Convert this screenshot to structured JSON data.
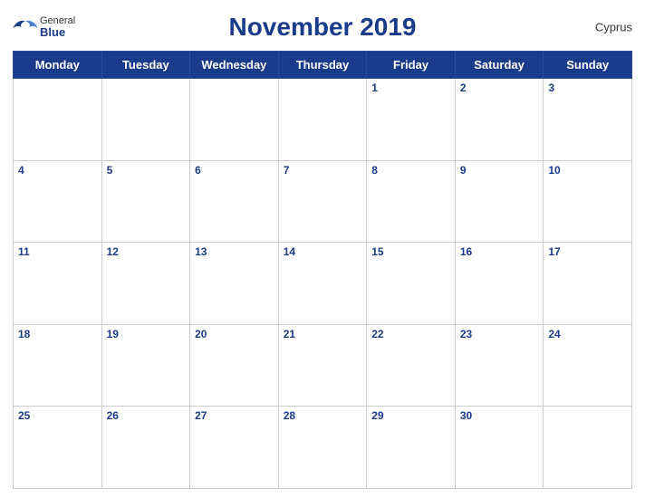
{
  "header": {
    "title": "November 2019",
    "country": "Cyprus",
    "logo": {
      "general": "General",
      "blue": "Blue"
    }
  },
  "weekdays": [
    "Monday",
    "Tuesday",
    "Wednesday",
    "Thursday",
    "Friday",
    "Saturday",
    "Sunday"
  ],
  "weeks": [
    [
      {
        "day": "",
        "empty": true
      },
      {
        "day": "",
        "empty": true
      },
      {
        "day": "",
        "empty": true
      },
      {
        "day": "",
        "empty": true
      },
      {
        "day": "1"
      },
      {
        "day": "2"
      },
      {
        "day": "3"
      }
    ],
    [
      {
        "day": "4"
      },
      {
        "day": "5"
      },
      {
        "day": "6"
      },
      {
        "day": "7"
      },
      {
        "day": "8"
      },
      {
        "day": "9"
      },
      {
        "day": "10"
      }
    ],
    [
      {
        "day": "11"
      },
      {
        "day": "12"
      },
      {
        "day": "13"
      },
      {
        "day": "14"
      },
      {
        "day": "15"
      },
      {
        "day": "16"
      },
      {
        "day": "17"
      }
    ],
    [
      {
        "day": "18"
      },
      {
        "day": "19"
      },
      {
        "day": "20"
      },
      {
        "day": "21"
      },
      {
        "day": "22"
      },
      {
        "day": "23"
      },
      {
        "day": "24"
      }
    ],
    [
      {
        "day": "25"
      },
      {
        "day": "26"
      },
      {
        "day": "27"
      },
      {
        "day": "28"
      },
      {
        "day": "29"
      },
      {
        "day": "30"
      },
      {
        "day": "",
        "empty": true
      }
    ]
  ]
}
